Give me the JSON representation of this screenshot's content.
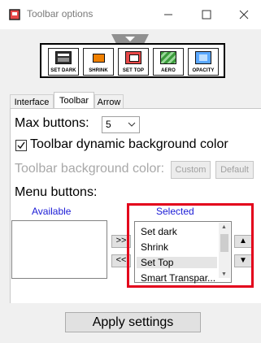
{
  "window": {
    "title": "Toolbar options",
    "controls": {
      "minimize_icon": "minimize-icon",
      "maximize_icon": "maximize-icon",
      "close_icon": "close-icon"
    }
  },
  "preview": {
    "buttons": [
      {
        "label": "SET DARK",
        "icon": "set-dark-icon",
        "color": "#202020"
      },
      {
        "label": "SHRINK",
        "icon": "shrink-icon",
        "color": "#f08000"
      },
      {
        "label": "SET TOP",
        "icon": "set-top-icon",
        "color": "#e84848"
      },
      {
        "label": "AERO",
        "icon": "aero-icon",
        "color": "#50b050"
      },
      {
        "label": "OPACITY",
        "icon": "opacity-icon",
        "color": "#5aa8ff"
      }
    ]
  },
  "tabs": [
    {
      "label": "Interface",
      "active": false
    },
    {
      "label": "Toolbar",
      "active": true
    },
    {
      "label": "Arrow",
      "active": false
    }
  ],
  "toolbar_tab": {
    "max_buttons_label": "Max buttons:",
    "max_buttons_value": "5",
    "dynamic_bg_checked": true,
    "dynamic_bg_label": "Toolbar dynamic background color",
    "bg_color_label": "Toolbar background color:",
    "custom_button": "Custom",
    "default_button": "Default",
    "menu_buttons_label": "Menu buttons:",
    "available_header": "Available",
    "selected_header": "Selected",
    "available_items": [],
    "selected_items": [
      "Set dark",
      "Shrink",
      "Set Top",
      "Smart Transpar..."
    ],
    "selected_highlighted_index": 2,
    "move_right_button": ">>",
    "move_left_button": "<<",
    "move_up_button": "▲",
    "move_down_button": "▼"
  },
  "apply_button": "Apply settings",
  "colors": {
    "accent_blue": "#1b1bd6",
    "highlight_red": "#e3001b",
    "disabled_text": "#a8a8a8"
  }
}
